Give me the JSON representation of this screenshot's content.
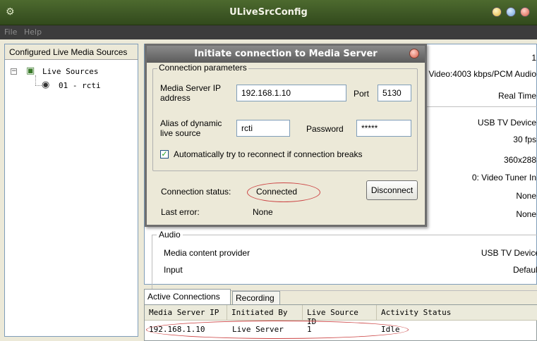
{
  "window": {
    "title": "ULiveSrcConfig"
  },
  "menu": {
    "file": "File",
    "help": "Help"
  },
  "left_pane": {
    "header": "Configured Live Media Sources",
    "tree": {
      "root_label": "Live Sources",
      "child_label": "01 - rcti",
      "expand_glyph": "−"
    }
  },
  "info_values": {
    "v1": "1",
    "v2": "Video:4003 kbps/PCM Audio",
    "v3": "Real Time",
    "v4": "USB TV Device",
    "v5": "30 fps",
    "v6": "360x288",
    "v7": "0: Video Tuner In",
    "v8": "None",
    "v9": "None"
  },
  "audio": {
    "legend": "Audio",
    "provider_label": "Media content provider",
    "provider_value": "USB TV Device",
    "input_label": "Input",
    "input_value": "Default"
  },
  "tabs": {
    "active": "Active Connections",
    "recording": "Recording"
  },
  "connections": {
    "columns": [
      "Media Server IP",
      "Initiated By",
      "Live Source ID",
      "Activity Status"
    ],
    "rows": [
      [
        "192.168.1.10",
        "Live Server",
        "1",
        "Idle"
      ]
    ]
  },
  "dialog": {
    "title": "Initiate connection to Media Server",
    "group_legend": "Connection parameters",
    "server_label": "Media Server IP address",
    "server_value": "192.168.1.10",
    "port_label": "Port",
    "port_value": "5130",
    "alias_label": "Alias of dynamic live source",
    "alias_value": "rcti",
    "password_label": "Password",
    "password_value": "*****",
    "auto_reconnect_label": "Automatically try to reconnect if connection breaks",
    "auto_reconnect_checked": true,
    "status_label": "Connection status:",
    "status_value": "Connected",
    "disconnect_label": "Disconnect",
    "error_label": "Last error:",
    "error_value": "None"
  },
  "colors": {
    "highlight_oval": "#cc4444",
    "title_bar": "#3f5926"
  }
}
